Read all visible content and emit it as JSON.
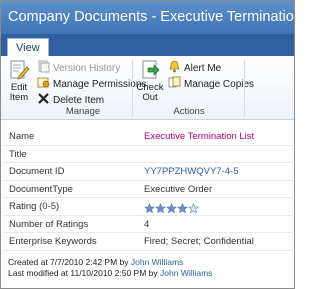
{
  "window": {
    "title": "Company Documents - Executive Termination List.docx"
  },
  "tabs": [
    {
      "label": "View"
    }
  ],
  "ribbon": {
    "manage_group": {
      "label": "Manage",
      "edit_item": "Edit\nItem",
      "version_history": "Version History",
      "manage_permissions": "Manage Permissions",
      "delete_item": "Delete Item"
    },
    "actions_group": {
      "label": "Actions",
      "check_out": "Check\nOut",
      "alert_me": "Alert Me",
      "manage_copies": "Manage Copies"
    }
  },
  "properties": [
    {
      "label": "Name",
      "value": "Executive Termination List"
    },
    {
      "label": "Title",
      "value": ""
    },
    {
      "label": "Document ID",
      "value": "YY7PPZHWQVY7-4-5"
    },
    {
      "label": "DocumentType",
      "value": "Executive Order"
    },
    {
      "label": "Rating (0-5)",
      "value": ""
    },
    {
      "label": "Number of Ratings",
      "value": "4"
    },
    {
      "label": "Enterprise Keywords",
      "value": "Fired; Secret; Confidential"
    }
  ],
  "rating": {
    "value": 4,
    "max": 5,
    "star_color": "#6a8fc9",
    "empty_color": "#dfe6f0"
  },
  "footer": {
    "created_prefix": "Created at 7/7/2010 2:42 PM  by ",
    "created_by": "John Williams",
    "modified_prefix": "Last modified at 11/10/2010 2:50 PM  by ",
    "modified_by": "John Williams"
  },
  "colors": {
    "title_bar": "#4a7fc0",
    "name_value": "#b40478",
    "link": "#2b62a5"
  }
}
